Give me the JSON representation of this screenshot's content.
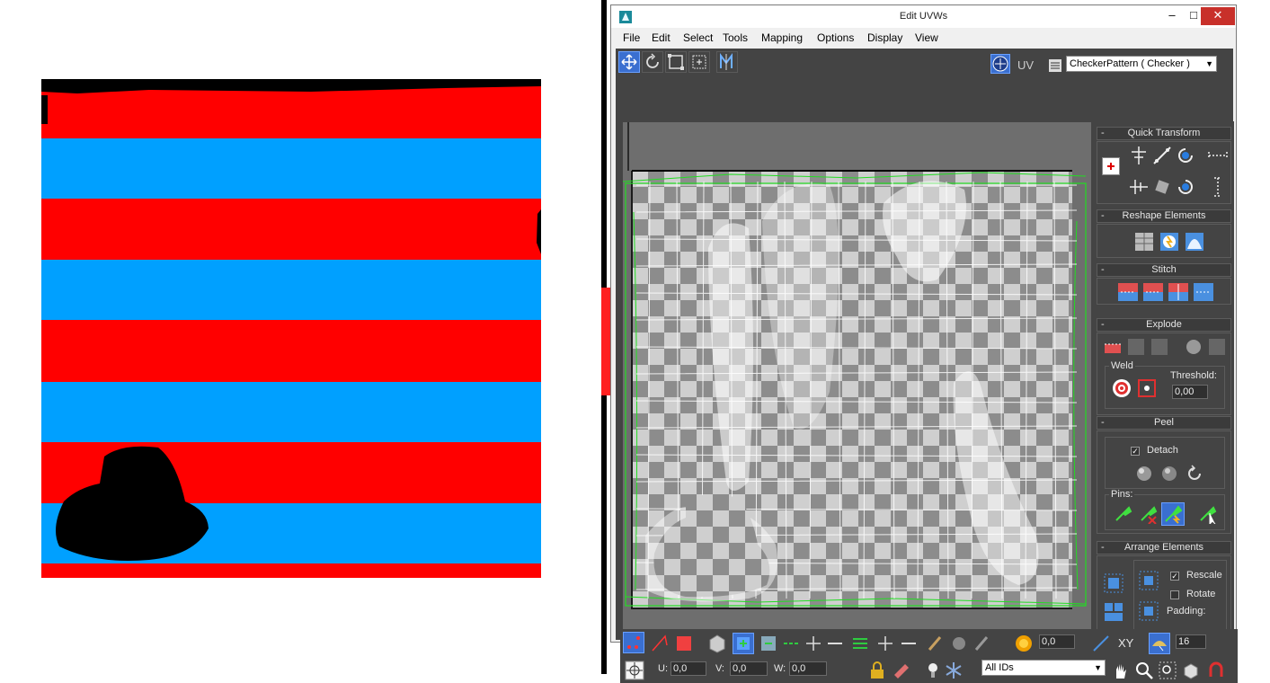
{
  "window": {
    "title": "Edit UVWs",
    "controls": {
      "minimize": "–",
      "maximize": "□",
      "close": "✕"
    }
  },
  "menu": [
    "File",
    "Edit",
    "Select",
    "Tools",
    "Mapping",
    "Options",
    "Display",
    "View"
  ],
  "top_toolbar": {
    "uv_label": "UV",
    "texture_dropdown": "CheckerPattern  ( Checker )"
  },
  "panel": {
    "quick_transform": "Quick Transform",
    "reshape_elements": "Reshape Elements",
    "stitch": "Stitch",
    "explode": "Explode",
    "weld_label": "Weld",
    "threshold_label": "Threshold:",
    "threshold_value": "0,00",
    "peel": "Peel",
    "detach_label": "Detach",
    "pins_label": "Pins:",
    "arrange_elements": "Arrange Elements",
    "rescale_label": "Rescale",
    "rotate_label": "Rotate",
    "padding_label": "Padding:",
    "collapse_symbol": "-"
  },
  "bottom_toolbar": {
    "soft_value": "0,0",
    "xy_label": "XY",
    "grid_value": "16",
    "u_label": "U:",
    "u_value": "0,0",
    "v_label": "V:",
    "v_value": "0,0",
    "w_label": "W:",
    "w_value": "0,0",
    "id_filter": "All IDs"
  },
  "colors": {
    "stripe_red": "#ff0000",
    "stripe_blue": "#00a0ff",
    "panel_bg": "#444444",
    "seam_green": "#22dd22",
    "highlight_blue": "#3a6fd0"
  }
}
